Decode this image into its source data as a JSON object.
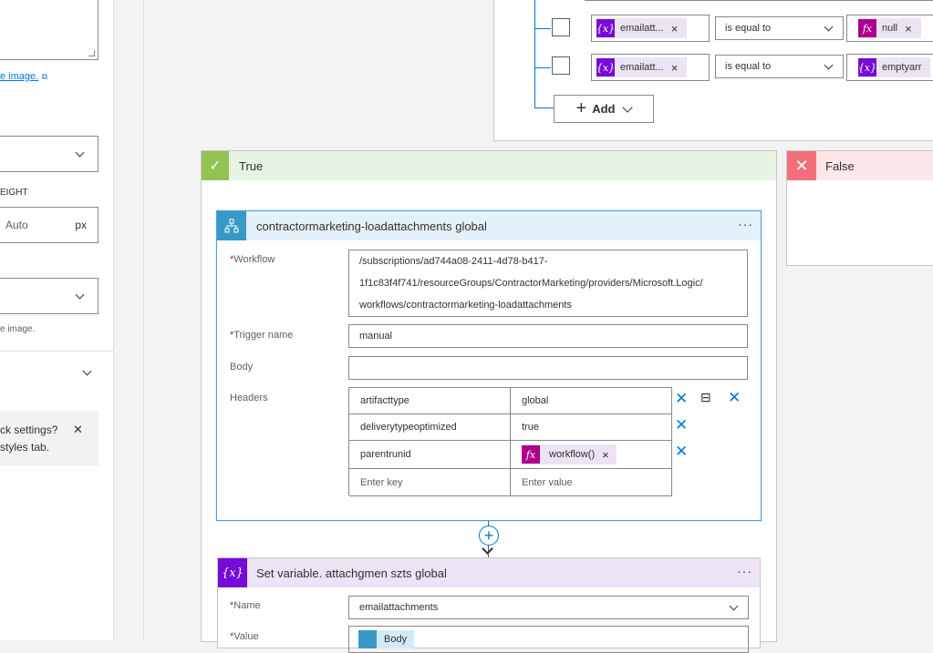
{
  "left_panel": {
    "link_text": "e image.",
    "select1_value": "",
    "height_label": "EIGHT",
    "height_value": "Auto",
    "height_unit": "px",
    "select2_value": "",
    "hint_text": "e image.",
    "tip_line1": "ck settings?",
    "tip_line2": "styles tab.",
    "tip_close": "✕"
  },
  "condition": {
    "rows": [
      {
        "left_token": "emailatt...",
        "operator": "is equal to",
        "right_token": "null",
        "right_icon": "fx-icon"
      },
      {
        "left_token": "emailatt...",
        "operator": "is equal to",
        "right_token": "emptyarr",
        "right_icon": "variable-icon"
      }
    ],
    "add_label": "Add",
    "token_var_glyph": "{x}",
    "token_fx_glyph": "fx"
  },
  "branches": {
    "true_label": "True",
    "false_label": "False"
  },
  "workflow_card": {
    "title": "contractormarketing-loadattachments global",
    "menu": "···",
    "workflow_label": "Workflow",
    "workflow_lines": [
      "/subscriptions/ad744a08-2411-4d78-b417-",
      "1f1c83f4f741/resourceGroups/ContractorMarketing/providers/Microsoft.Logic/",
      "workflows/contractormarketing-loadattachments"
    ],
    "trigger_label": "Trigger name",
    "trigger_value": "manual",
    "body_label": "Body",
    "body_value": "",
    "headers_label": "Headers",
    "headers": [
      {
        "key": "artifacttype",
        "value": "global"
      },
      {
        "key": "deliverytypeoptimized",
        "value": "true"
      },
      {
        "key": "parentrunid",
        "value": "workflow()"
      }
    ],
    "key_placeholder": "Enter key",
    "value_placeholder": "Enter value"
  },
  "setvar_card": {
    "title": "Set variable. attachgmen szts global",
    "menu": "···",
    "name_label": "Name",
    "name_value": "emailattachments",
    "value_label": "Value",
    "value_token": "Body"
  },
  "colors": {
    "accent": "#0078d4",
    "variable": "#770bd6",
    "expression": "#ad008c",
    "true_green": "#92c353",
    "false_red": "#f1707b"
  }
}
